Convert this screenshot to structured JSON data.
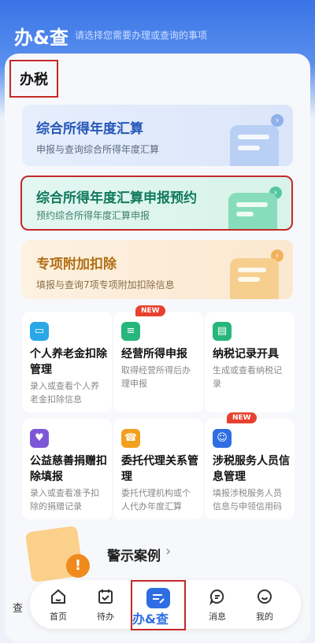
{
  "header": {
    "title": "办&查",
    "subtitle": "请选择您需要办理或查询的事项"
  },
  "section": {
    "title": "办税"
  },
  "cards": [
    {
      "title": "综合所得年度汇算",
      "desc": "申报与查询综合所得年度汇算",
      "accent": "#2556b8"
    },
    {
      "title": "综合所得年度汇算申报预约",
      "desc": "预约综合所得年度汇算申报",
      "accent": "#107a5a"
    },
    {
      "title": "专项附加扣除",
      "desc": "填报与查询7项专项附加扣除信息",
      "accent": "#b06d12"
    }
  ],
  "tiles": [
    {
      "name": "个人养老金扣除管理",
      "desc": "录入或查看个人养老金扣除信息",
      "icon": "pension-card-icon",
      "color": "#2aa8e6"
    },
    {
      "name": "经营所得申报",
      "desc": "取得经营所得后办理申报",
      "icon": "business-tax-icon",
      "color": "#27b67c",
      "badge": "NEW"
    },
    {
      "name": "纳税记录开具",
      "desc": "生成或查看纳税记录",
      "icon": "tax-record-icon",
      "color": "#27b67c"
    },
    {
      "name": "公益慈善捐赠扣除填报",
      "desc": "录入或查看准予扣除的捐赠记录",
      "icon": "donation-icon",
      "color": "#7e57d9"
    },
    {
      "name": "委托代理关系管理",
      "desc": "委托代理机构或个人代办年度汇算",
      "icon": "agent-icon",
      "color": "#f2a01e"
    },
    {
      "name": "涉税服务人员信息管理",
      "desc": "填报涉税服务人员信息与申领信用码",
      "icon": "staff-info-icon",
      "color": "#2f6de3",
      "badge": "NEW"
    }
  ],
  "warning": {
    "title": "警示案例",
    "chevron": "›"
  },
  "tabbar": {
    "items": [
      {
        "label": "首页",
        "icon": "home-icon"
      },
      {
        "label": "待办",
        "icon": "calendar-check-icon"
      },
      {
        "label": "办&查",
        "icon": "edit-doc-icon",
        "active": true
      },
      {
        "label": "消息",
        "icon": "message-icon"
      },
      {
        "label": "我的",
        "icon": "smile-face-icon"
      }
    ]
  },
  "left_peek": "查"
}
